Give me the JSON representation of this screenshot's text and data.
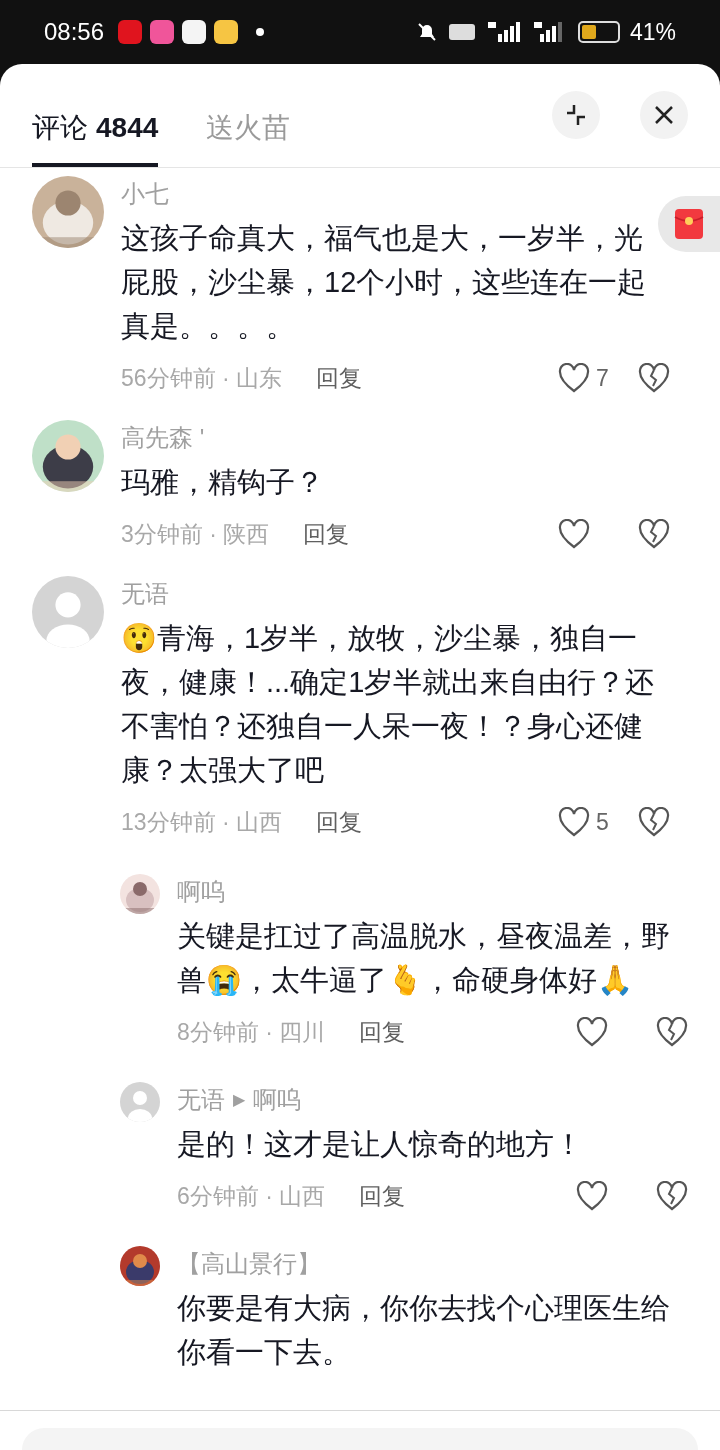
{
  "status_bar": {
    "time": "08:56",
    "battery": "41%"
  },
  "tabs": [
    {
      "label": "评论",
      "count": "4844",
      "selected": true
    },
    {
      "label": "送火苗",
      "selected": false
    }
  ],
  "comments": [
    {
      "name": "小七",
      "text": "这孩子命真大，福气也是大，一岁半，光屁股，沙尘暴，12个小时，这些连在一起真是。。。。",
      "time": "56分钟前 · 山东",
      "reply": "回复",
      "likes": "7"
    },
    {
      "name": "高先森 '",
      "text": "玛雅，精钩子？",
      "time": "3分钟前 · 陕西",
      "reply": "回复"
    },
    {
      "name": "无语",
      "avatar": {
        "kind": "default"
      },
      "text": "😲青海，1岁半，放牧，沙尘暴，独自一夜，健康！...确定1岁半就出来自由行？还不害怕？还独自一人呆一夜！？身心还健康？太强大了吧",
      "time": "13分钟前 · 山西",
      "reply": "回复",
      "likes": "5",
      "children": [
        {
          "name": "啊呜",
          "text": "关键是扛过了高温脱水，昼夜温差，野兽😭，太牛逼了🫰，命硬身体好🙏",
          "time": "8分钟前 · 四川",
          "reply": "回复"
        },
        {
          "name": "无语",
          "reply_arrow": "▶",
          "reply_to": "啊呜",
          "avatar": {
            "kind": "default"
          },
          "text": "是的！这才是让人惊奇的地方！",
          "time": "6分钟前 · 山西",
          "reply": "回复"
        },
        {
          "name": "【高山景行】",
          "text": "你要是有大病，你你去找个心理医生给你看一下去。"
        }
      ]
    }
  ]
}
